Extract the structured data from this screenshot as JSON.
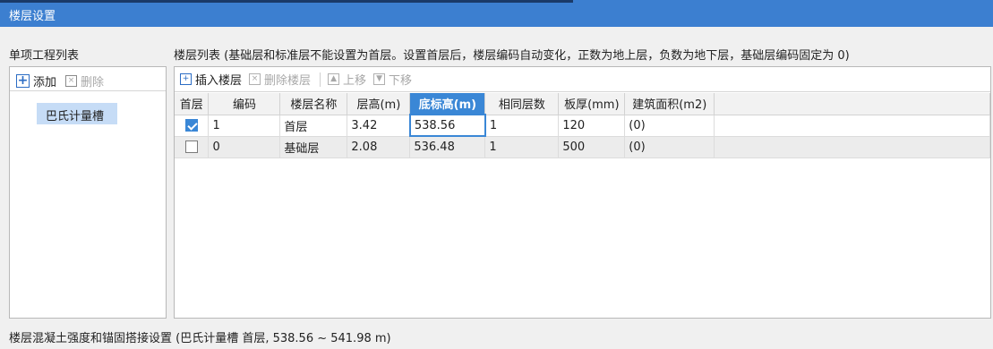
{
  "window": {
    "title": "楼层设置"
  },
  "left": {
    "title": "单项工程列表",
    "add_label": "添加",
    "delete_label": "删除",
    "items": [
      "巴氏计量槽"
    ]
  },
  "right": {
    "title": "楼层列表 (基础层和标准层不能设置为首层。设置首层后，楼层编码自动变化，正数为地上层，负数为地下层，基础层编码固定为 0)",
    "toolbar": {
      "insert_label": "插入楼层",
      "delete_label": "删除楼层",
      "up_label": "上移",
      "down_label": "下移"
    },
    "columns": [
      "首层",
      "编码",
      "楼层名称",
      "层高(m)",
      "底标高(m)",
      "相同层数",
      "板厚(mm)",
      "建筑面积(m2)"
    ],
    "rows": [
      {
        "first": true,
        "code": "1",
        "name": "首层",
        "height": "3.42",
        "bottom": "538.56",
        "same": "1",
        "thickness": "120",
        "area": "(0)"
      },
      {
        "first": false,
        "code": "0",
        "name": "基础层",
        "height": "2.08",
        "bottom": "536.48",
        "same": "1",
        "thickness": "500",
        "area": "(0)"
      }
    ]
  },
  "status": "楼层混凝土强度和锚固搭接设置 (巴氏计量槽 首层, 538.56 ~ 541.98 m)",
  "colors": {
    "titlebar": "#3c7fd0",
    "accent": "#3a87d6",
    "selected_item": "#c6dcf6"
  }
}
